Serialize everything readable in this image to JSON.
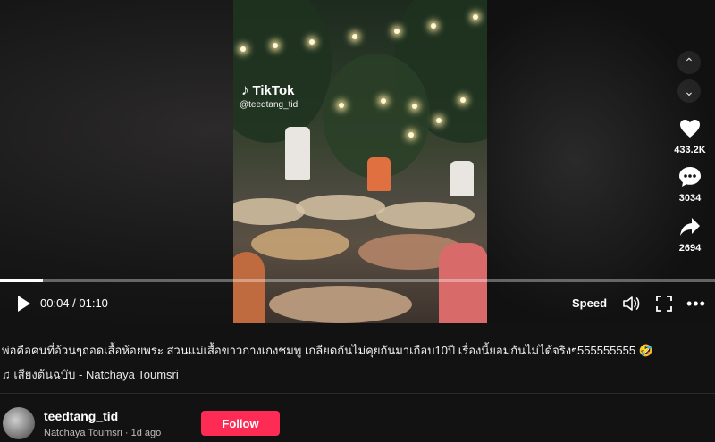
{
  "video": {
    "watermark_brand": "TikTok",
    "watermark_handle": "@teedtang_tid"
  },
  "controls": {
    "current_time": "00:04",
    "duration": "01:10",
    "time_display": "00:04 / 01:10",
    "progress_fraction": 0.06,
    "speed_label": "Speed"
  },
  "side_actions": {
    "likes": "433.2K",
    "comments": "3034",
    "shares": "2694"
  },
  "post": {
    "caption": "พ่อคือคนที่อ้วนๆถอดเสื้อห้อยพระ ส่วนแม่เสื้อขาวกางเกงชมพู เกลียดกันไม่คุยกันมาเกือบ10ปี เรื่องนี้ยอมกันไม่ได้จริงๆ555555555 🤣",
    "music": "♫ เสียงต้นฉบับ - Natchaya Toumsri"
  },
  "author": {
    "username": "teedtang_tid",
    "display_name": "Natchaya Toumsri",
    "posted": "1d ago",
    "meta_line": "Natchaya Toumsri · 1d ago",
    "follow_label": "Follow"
  },
  "colors": {
    "follow_button": "#fe2c55",
    "background": "#121212"
  }
}
